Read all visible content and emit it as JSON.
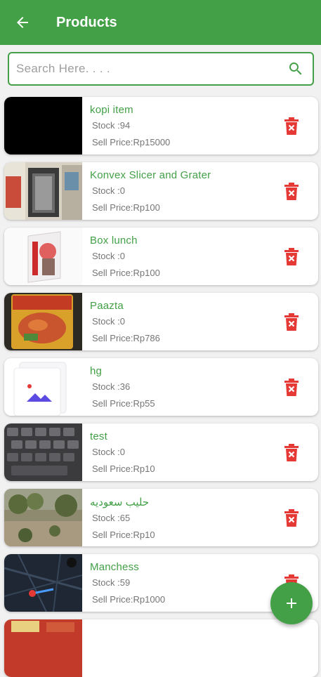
{
  "appbar": {
    "title": "Products"
  },
  "search": {
    "placeholder": "Search Here. . . ."
  },
  "products": [
    {
      "name": "kopi item",
      "stock": "Stock :94",
      "price": "Sell Price:Rp15000"
    },
    {
      "name": "Konvex Slicer and Grater",
      "stock": "Stock :0",
      "price": "Sell Price:Rp100"
    },
    {
      "name": "Box lunch",
      "stock": "Stock :0",
      "price": "Sell Price:Rp100"
    },
    {
      "name": "Paazta",
      "stock": "Stock :0",
      "price": "Sell Price:Rp786"
    },
    {
      "name": "hg",
      "stock": "Stock :36",
      "price": "Sell Price:Rp55"
    },
    {
      "name": "test",
      "stock": "Stock :0",
      "price": "Sell Price:Rp10"
    },
    {
      "name": "حليب سعوديه",
      "stock": "Stock :65",
      "price": "Sell Price:Rp10"
    },
    {
      "name": "Manchess",
      "stock": "Stock :59",
      "price": "Sell Price:Rp1000"
    }
  ],
  "colors": {
    "primary": "#43a047",
    "delete": "#e53935"
  },
  "icons": {
    "back": "arrow-back-icon",
    "search": "search-icon",
    "delete": "delete-icon",
    "add": "add-icon"
  }
}
